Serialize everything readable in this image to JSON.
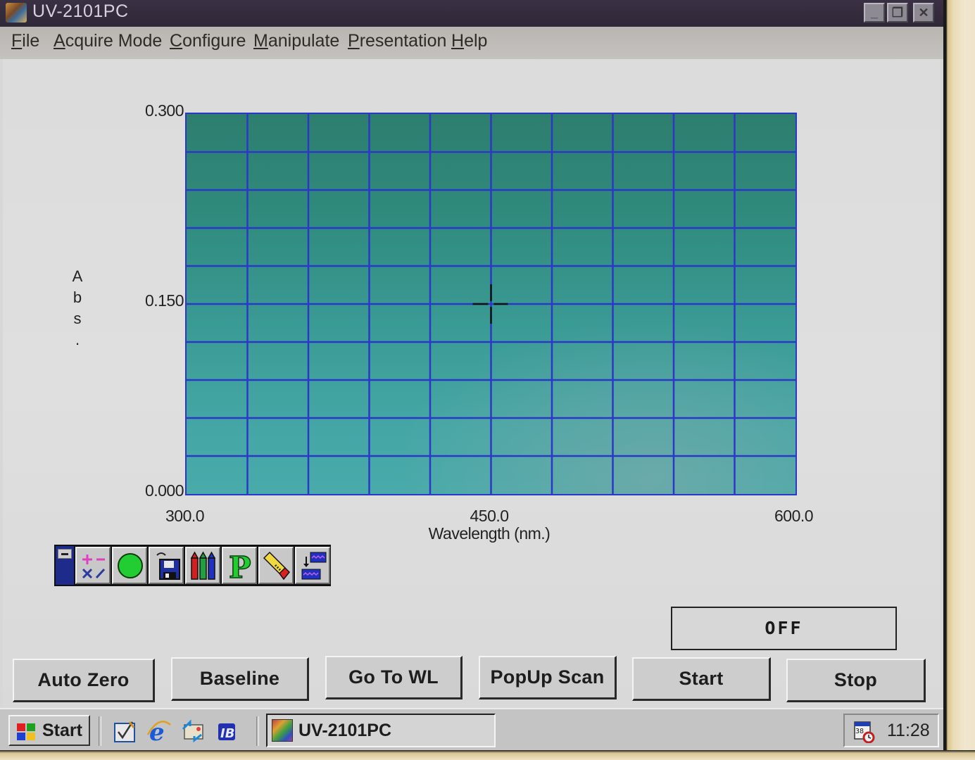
{
  "window": {
    "title": "UV-2101PC",
    "controls": {
      "minimize": "_",
      "restore": "❐",
      "close": "✕"
    }
  },
  "menu": [
    {
      "label": "File",
      "mnemonic": "F",
      "rest": "ile"
    },
    {
      "label": "Acquire Mode",
      "mnemonic": "A",
      "rest": "cquire Mode"
    },
    {
      "label": "Configure",
      "mnemonic": "C",
      "rest": "onfigure"
    },
    {
      "label": "Manipulate",
      "mnemonic": "M",
      "rest": "anipulate"
    },
    {
      "label": "Presentation",
      "mnemonic": "P",
      "rest": "resentation"
    },
    {
      "label": "Help",
      "mnemonic": "H",
      "rest": "elp"
    }
  ],
  "chart_data": {
    "type": "line",
    "title": "",
    "xlabel": "Wavelength (nm.)",
    "ylabel": "Abs.",
    "ylabel_chars": [
      "A",
      "b",
      "s",
      "."
    ],
    "xlim": [
      300.0,
      600.0
    ],
    "ylim": [
      0.0,
      0.3
    ],
    "x_ticks": [
      "300.0",
      "450.0",
      "600.0"
    ],
    "x_tick_values": [
      300.0,
      450.0,
      600.0
    ],
    "y_ticks": [
      "0.300",
      "0.150",
      "0.000"
    ],
    "y_tick_values": [
      0.3,
      0.15,
      0.0
    ],
    "grid": true,
    "grid_divisions": {
      "x": 10,
      "y": 10
    },
    "series": [],
    "cursor": {
      "x": 450.0,
      "y": 0.15
    },
    "colors": {
      "grid": "#2a38c8",
      "cursor": "#111111"
    }
  },
  "toolbar": {
    "tools": [
      {
        "name": "math-operations",
        "icon": "math-ops-icon"
      },
      {
        "name": "record",
        "icon": "green-circle-icon"
      },
      {
        "name": "save",
        "icon": "floppy-disk-icon"
      },
      {
        "name": "pens",
        "icon": "crayons-icon"
      },
      {
        "name": "print",
        "icon": "p-icon"
      },
      {
        "name": "erase",
        "icon": "eraser-icon"
      },
      {
        "name": "overlay",
        "icon": "overlay-spectra-icon"
      }
    ]
  },
  "status": {
    "lamp": "OFF"
  },
  "actions": [
    {
      "id": "auto-zero",
      "label": "Auto Zero"
    },
    {
      "id": "baseline",
      "label": "Baseline"
    },
    {
      "id": "go-to-wl",
      "label": "Go To WL"
    },
    {
      "id": "popup-scan",
      "label": "PopUp Scan"
    },
    {
      "id": "start",
      "label": "Start"
    },
    {
      "id": "stop",
      "label": "Stop"
    }
  ],
  "taskbar": {
    "start_label": "Start",
    "task_label": "UV-2101PC",
    "clock": "11:28"
  }
}
